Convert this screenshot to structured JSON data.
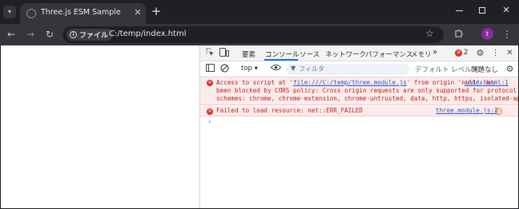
{
  "browser": {
    "tab": {
      "title": "Three.js ESM Sample",
      "close": "✕"
    },
    "new_tab": "+",
    "window": {
      "close": "✕"
    }
  },
  "toolbar": {
    "back": "←",
    "forward": "→",
    "reload": "↻",
    "omnibox": {
      "chip_label": "ファイル",
      "url": "C:/temp/index.html"
    },
    "bookmark": "☆",
    "profile_initial": "t",
    "menu": "⋮"
  },
  "devtools": {
    "tabs": [
      "要素",
      "コンソール",
      "ソース",
      "ネットワーク",
      "パフォーマンス",
      "メモリ"
    ],
    "active_tab": "コンソール",
    "more_tabs": "»",
    "error_count": "2",
    "filter": {
      "context": "top ▾",
      "placeholder": "フィルタ",
      "levels": "デフォルト レベル ▾",
      "issues": "問題なし"
    },
    "messages": [
      {
        "level": "error",
        "lines": [
          [
            "Access to script at '",
            "file:///C:/temp/three.module.js",
            "' from origin 'null' has "
          ],
          [
            "been blocked by CORS policy: Cross origin requests are only supported for protocol"
          ],
          [
            "schemes: chrome, chrome-extension, chrome-untrusted, data, http, https, isolated-app."
          ]
        ],
        "source": "index.html:1"
      },
      {
        "level": "error",
        "text": "Failed to load resource: net::ERR_FAILED",
        "source": "three.module.js:1"
      }
    ],
    "prompt": "›"
  },
  "colors": {
    "chrome_dark": "#1f2023",
    "toolbar": "#35363a",
    "error_bg": "#fcebeb",
    "error_text": "#b3261e",
    "link": "#2b57c4",
    "accent": "#1a73e8"
  }
}
